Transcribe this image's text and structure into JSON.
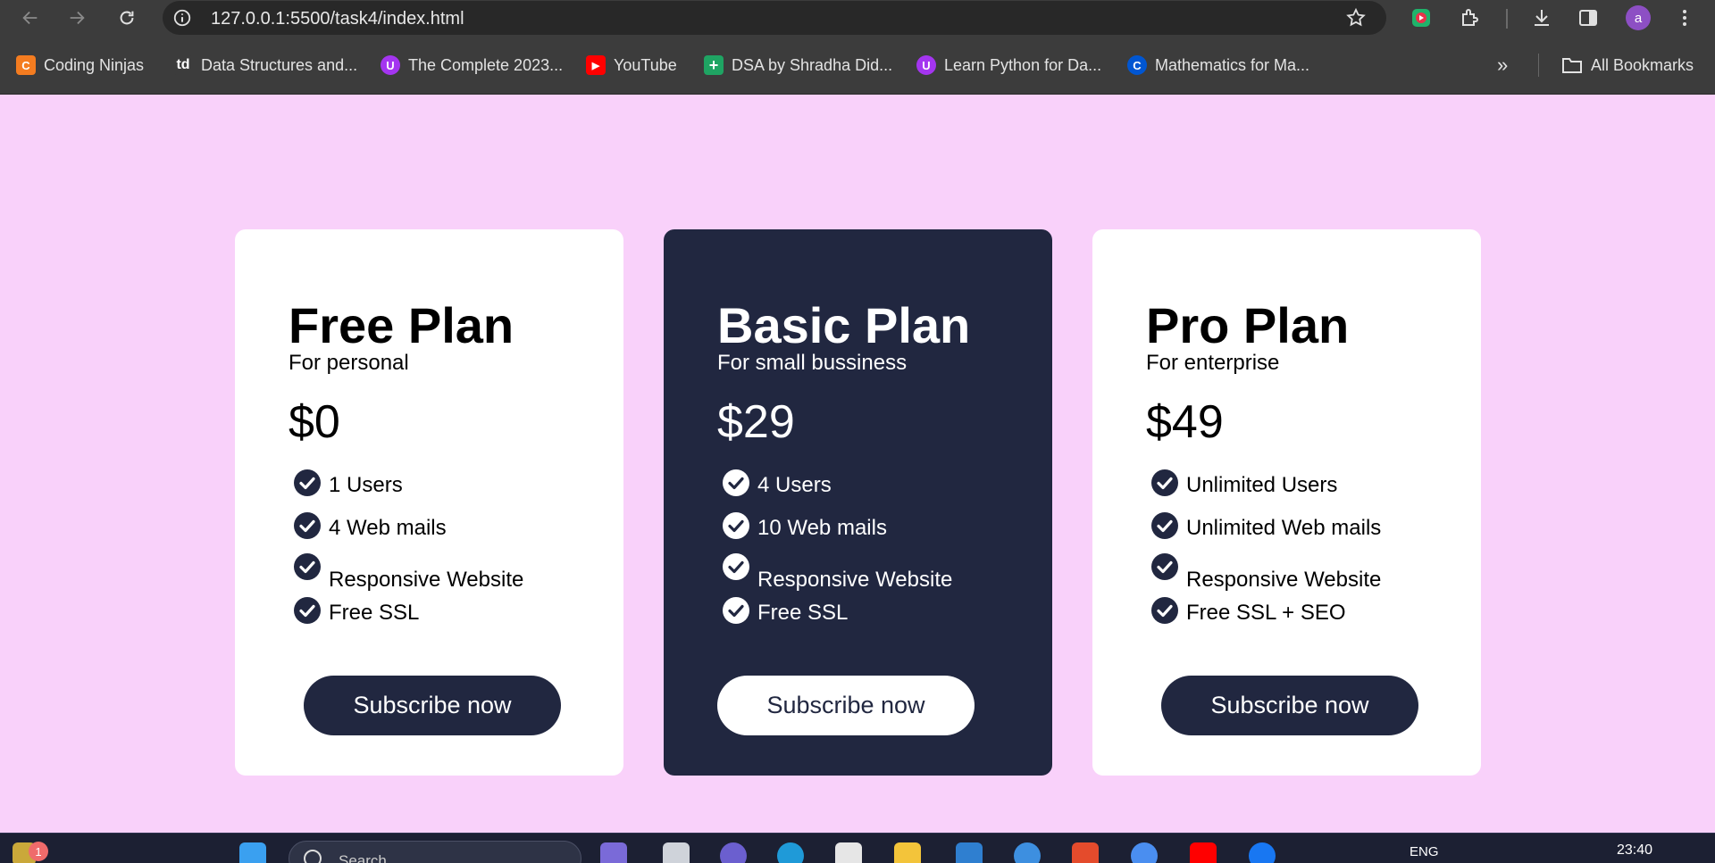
{
  "browser": {
    "url": "127.0.0.1:5500/task4/index.html",
    "profile_initial": "a"
  },
  "bookmarks": {
    "items": [
      {
        "label": "Coding Ninjas",
        "icon": "coding-ninjas-icon",
        "color": "#f47c20",
        "glyph": "C"
      },
      {
        "label": "Data Structures and...",
        "icon": "td-icon",
        "color": "#3c3c3c",
        "glyph": "td"
      },
      {
        "label": "The Complete 2023...",
        "icon": "udemy-icon",
        "color": "#a435f0",
        "glyph": "U"
      },
      {
        "label": "YouTube",
        "icon": "youtube-icon",
        "color": "#ff0000",
        "glyph": "▶"
      },
      {
        "label": "DSA by Shradha Did...",
        "icon": "sheets-icon",
        "color": "#1fa463",
        "glyph": "+"
      },
      {
        "label": "Learn Python for Da...",
        "icon": "udemy-icon",
        "color": "#a435f0",
        "glyph": "U"
      },
      {
        "label": "Mathematics for Ma...",
        "icon": "coursera-icon",
        "color": "#0056d2",
        "glyph": "C"
      }
    ],
    "all_bookmarks_label": "All Bookmarks"
  },
  "plans": [
    {
      "title": "Free Plan",
      "subtitle": "For personal",
      "price": "$0",
      "features": [
        "1 Users",
        "4 Web mails",
        "Responsive Website",
        "Free SSL"
      ],
      "button": "Subscribe now",
      "theme": "light"
    },
    {
      "title": "Basic Plan",
      "subtitle": "For small bussiness",
      "price": "$29",
      "features": [
        "4 Users",
        "10 Web mails",
        "Responsive Website",
        "Free SSL"
      ],
      "button": "Subscribe now",
      "theme": "dark"
    },
    {
      "title": "Pro Plan",
      "subtitle": "For enterprise",
      "price": "$49",
      "features": [
        "Unlimited Users",
        "Unlimited Web mails",
        "Responsive Website",
        "Free SSL + SEO"
      ],
      "button": "Subscribe now",
      "theme": "light"
    }
  ],
  "colors": {
    "page_background": "#f9d1fa",
    "card_dark": "#212740",
    "card_light": "#ffffff",
    "browser_chrome": "#3c3c3c"
  },
  "taskbar": {
    "search_placeholder": "Search",
    "notification_count": "1",
    "language": "ENG",
    "time": "23:40"
  }
}
